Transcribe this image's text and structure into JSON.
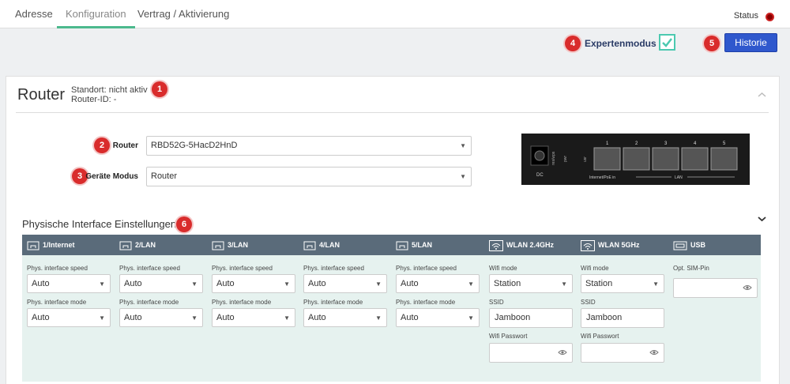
{
  "tabs": [
    "Adresse",
    "Konfiguration",
    "Vertrag / Aktivierung"
  ],
  "status_label": "Status",
  "colors": {
    "accent": "#4cb98d",
    "primary_button": "#2f58cd",
    "badge": "#d92c2c",
    "status_dot": "#8b0000",
    "interface_header": "#5a6b7a",
    "interface_body": "#e6f2ef"
  },
  "toolbar": {
    "expert_mode_label": "Expertenmodus",
    "expert_mode_checked": true,
    "history_label": "Historie",
    "badge_expert": "4",
    "badge_history": "5"
  },
  "router": {
    "title": "Router",
    "location": "Standort: nicht aktiv",
    "router_id": "Router-ID: -",
    "badge": "1",
    "router_label": "Router",
    "router_badge": "2",
    "router_value": "RBD52G-5HacD2HnD",
    "mode_label": "Geräte Modus",
    "mode_badge": "3",
    "mode_value": "Router",
    "device_ports": [
      "1",
      "2",
      "3",
      "4",
      "5"
    ],
    "device_text_dc": "DC",
    "device_text_reset": "res/wps",
    "device_text_pwr": "pwr",
    "device_text_usr": "usr",
    "device_text_poe": "Internet/PoE in",
    "device_text_lan": "LAN"
  },
  "interfaces": {
    "title": "Physische Interface Einstellungen",
    "badge": "6",
    "wired": [
      {
        "name": "1/Internet",
        "speed_label": "Phys. interface speed",
        "speed": "Auto",
        "mode_label": "Phys. interface mode",
        "mode": "Auto"
      },
      {
        "name": "2/LAN",
        "speed_label": "Phys. interface speed",
        "speed": "Auto",
        "mode_label": "Phys. interface mode",
        "mode": "Auto"
      },
      {
        "name": "3/LAN",
        "speed_label": "Phys. interface speed",
        "speed": "Auto",
        "mode_label": "Phys. interface mode",
        "mode": "Auto"
      },
      {
        "name": "4/LAN",
        "speed_label": "Phys. interface speed",
        "speed": "Auto",
        "mode_label": "Phys. interface mode",
        "mode": "Auto"
      },
      {
        "name": "5/LAN",
        "speed_label": "Phys. interface speed",
        "speed": "Auto",
        "mode_label": "Phys. interface mode",
        "mode": "Auto"
      }
    ],
    "wifi": [
      {
        "name": "WLAN 2.4GHz",
        "mode_label": "Wifi mode",
        "mode": "Station",
        "ssid_label": "SSID",
        "ssid": "Jamboon",
        "password_label": "Wifi Passwort",
        "password": ""
      },
      {
        "name": "WLAN 5GHz",
        "mode_label": "Wifi mode",
        "mode": "Station",
        "ssid_label": "SSID",
        "ssid": "Jamboon",
        "password_label": "Wifi Passwort",
        "password": ""
      }
    ],
    "usb": {
      "name": "USB",
      "pin_label": "Opt. SIM-Pin",
      "pin": ""
    }
  }
}
